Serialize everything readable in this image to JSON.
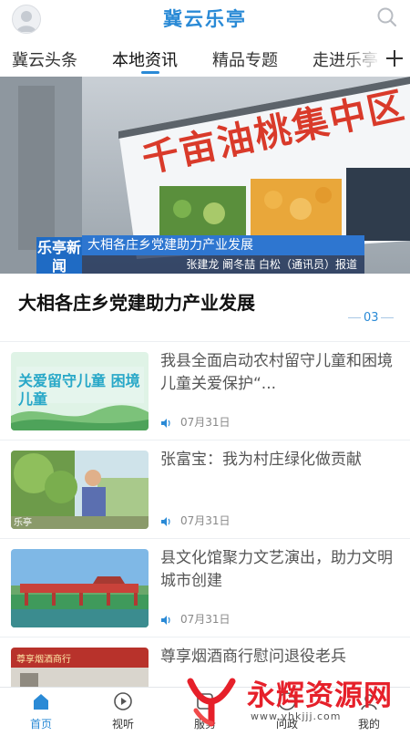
{
  "header": {
    "app_title": "冀云乐亭",
    "avatar_icon": "user-avatar-icon",
    "search_icon": "search-icon"
  },
  "tabs": [
    {
      "label": "冀云头条",
      "active": false
    },
    {
      "label": "本地资讯",
      "active": true
    },
    {
      "label": "精品专题",
      "active": false
    },
    {
      "label": "走进乐亭",
      "active": false
    }
  ],
  "add_channel_icon": "plus-icon",
  "banner": {
    "billboard_text": "千亩油桃集中区",
    "news_logo": "乐亭新闻",
    "ticker_title": "大相各庄乡党建助力产业发展",
    "ticker_credit": "张建龙  阚冬喆  白松（通讯员）报道",
    "headline": "大相各庄乡党建助力产业发展",
    "slide_index": "03"
  },
  "news": [
    {
      "title": "我县全面启动农村留守儿童和困境儿童关爱保护“...",
      "date": "07月31日",
      "thumb_text": "关爱留守儿童 困境儿童"
    },
    {
      "title": "张富宝：我为村庄绿化做贡献",
      "date": "07月31日",
      "thumb_text": "乐亭"
    },
    {
      "title": "县文化馆聚力文艺演出，助力文明城市创建",
      "date": "07月31日",
      "thumb_text": ""
    },
    {
      "title": "尊享烟酒商行慰问退役老兵",
      "date": "",
      "thumb_text": "尊享烟酒商行"
    }
  ],
  "bottom_nav": [
    {
      "label": "首页",
      "icon": "home-icon",
      "active": true
    },
    {
      "label": "视听",
      "icon": "play-icon",
      "active": false
    },
    {
      "label": "服务",
      "icon": "service-icon",
      "active": false
    },
    {
      "label": "问政",
      "icon": "question-icon",
      "active": false
    },
    {
      "label": "我的",
      "icon": "user-icon",
      "active": false
    }
  ],
  "watermark": {
    "title": "永辉资源网",
    "url": "www.yhkjjj.com"
  },
  "colors": {
    "accent": "#2a8ad6",
    "watermark_red": "#e6202a"
  }
}
